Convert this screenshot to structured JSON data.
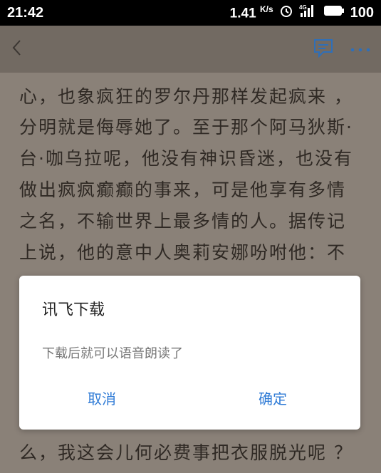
{
  "status_bar": {
    "time": "21:42",
    "speed": "1.41",
    "speed_unit": "K/s",
    "signal_label": "4G",
    "battery": "100"
  },
  "toolbar": {
    "back_icon": "chevron-left-icon",
    "comment_icon": "comment-icon",
    "more_icon": "more-icon"
  },
  "reading": {
    "lines": [
      "心，也象疯狂的罗尔丹那样发起疯来 ，",
      "分明就是侮辱她了。至于那个阿马狄斯·",
      "台·咖乌拉呢，他没有神识昏迷，也没有",
      "做出疯疯癫癫的事来，可是他享有多情",
      "之名，不输世界上最多情的人。据传记",
      "上说，他的意中人奥莉安娜吩咐他：不",
      "么，我这会儿何必费事把衣服脱光呢 ？"
    ]
  },
  "dialog": {
    "title": "讯飞下载",
    "message": "下载后就可以语音朗读了",
    "cancel_label": "取消",
    "ok_label": "确定"
  },
  "colors": {
    "accent": "#2f7bd6",
    "overlay_background": "#8a8178",
    "toolbar_background": "#726a62"
  }
}
